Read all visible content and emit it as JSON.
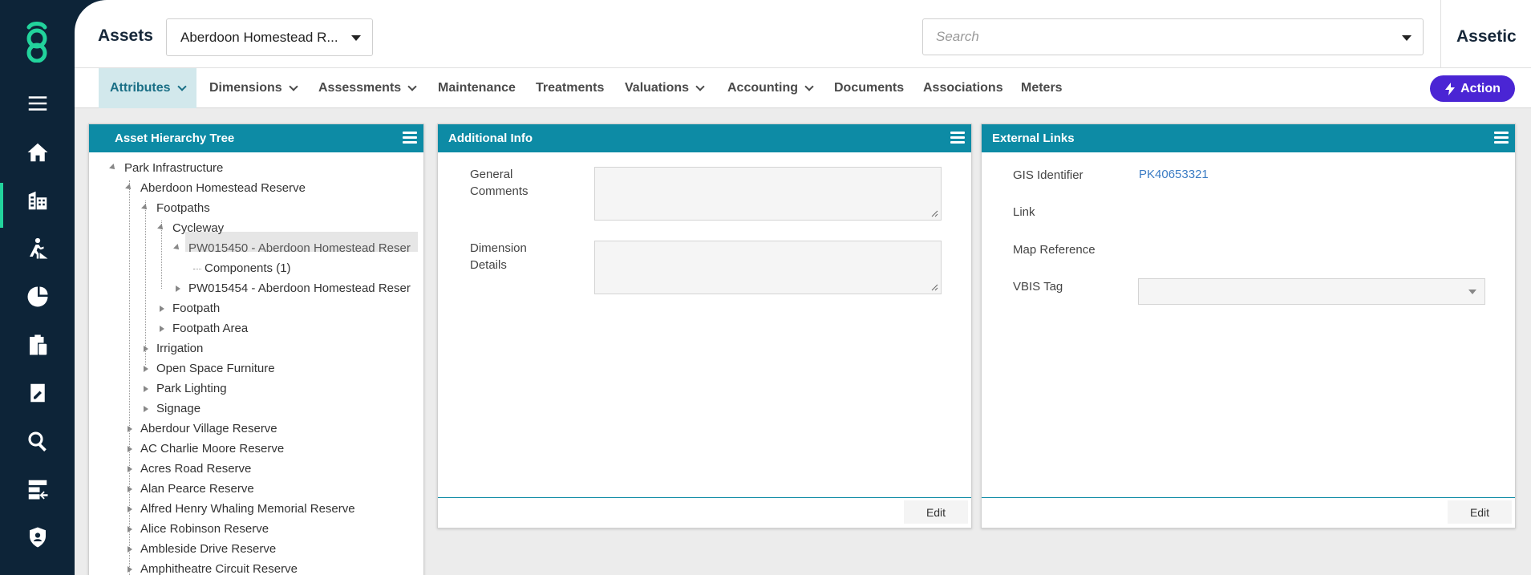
{
  "header": {
    "title": "Assets",
    "asset_selector": "Aberdoon Homestead R...",
    "search_placeholder": "Search",
    "brand": "Assetic"
  },
  "tabs": [
    {
      "label": "Attributes",
      "dropdown": true,
      "active": true
    },
    {
      "label": "Dimensions",
      "dropdown": true
    },
    {
      "label": "Assessments",
      "dropdown": true
    },
    {
      "label": "Maintenance",
      "dropdown": false
    },
    {
      "label": "Treatments",
      "dropdown": false
    },
    {
      "label": "Valuations",
      "dropdown": true
    },
    {
      "label": "Accounting",
      "dropdown": true
    },
    {
      "label": "Documents",
      "dropdown": false
    },
    {
      "label": "Associations",
      "dropdown": false
    },
    {
      "label": "Meters",
      "dropdown": false
    }
  ],
  "action_button": "Action",
  "sidebar": {
    "icons": [
      "menu-icon",
      "home-icon",
      "buildings-icon",
      "worker-icon",
      "finance-icon",
      "clipboard-calc-icon",
      "edit-doc-icon",
      "search-icon",
      "data-import-icon",
      "shield-user-icon"
    ]
  },
  "hierarchy_tree": {
    "title": "Asset Hierarchy Tree",
    "nodes": [
      {
        "label": "Park Infrastructure"
      },
      {
        "label": "Aberdoon Homestead Reserve"
      },
      {
        "label": "Footpaths"
      },
      {
        "label": "Cycleway"
      },
      {
        "label": "PW015450 - Aberdoon Homestead Reser"
      },
      {
        "label": "Components (1)"
      },
      {
        "label": "PW015454 - Aberdoon Homestead Reser"
      },
      {
        "label": "Footpath"
      },
      {
        "label": "Footpath Area"
      },
      {
        "label": "Irrigation"
      },
      {
        "label": "Open Space Furniture"
      },
      {
        "label": "Park Lighting"
      },
      {
        "label": "Signage"
      },
      {
        "label": "Aberdour Village Reserve"
      },
      {
        "label": "AC Charlie Moore Reserve"
      },
      {
        "label": "Acres Road Reserve"
      },
      {
        "label": "Alan Pearce Reserve"
      },
      {
        "label": "Alfred Henry Whaling Memorial Reserve"
      },
      {
        "label": "Alice Robinson Reserve"
      },
      {
        "label": "Ambleside Drive Reserve"
      },
      {
        "label": "Amphitheatre Circuit Reserve"
      }
    ]
  },
  "additional_info": {
    "title": "Additional Info",
    "general_comments_label_1": "General",
    "general_comments_label_2": "Comments",
    "dimension_details_label_1": "Dimension",
    "dimension_details_label_2": "Details",
    "edit": "Edit"
  },
  "external_links": {
    "title": "External Links",
    "gis_label": "GIS Identifier",
    "gis_value": "PK40653321",
    "link_label": "Link",
    "map_ref_label": "Map Reference",
    "vbis_label": "VBIS Tag",
    "edit": "Edit"
  },
  "colors": {
    "rail": "#0d2438",
    "panel_header": "#0d8ba5",
    "action": "#4a25d4",
    "logo": "#22d39c"
  }
}
